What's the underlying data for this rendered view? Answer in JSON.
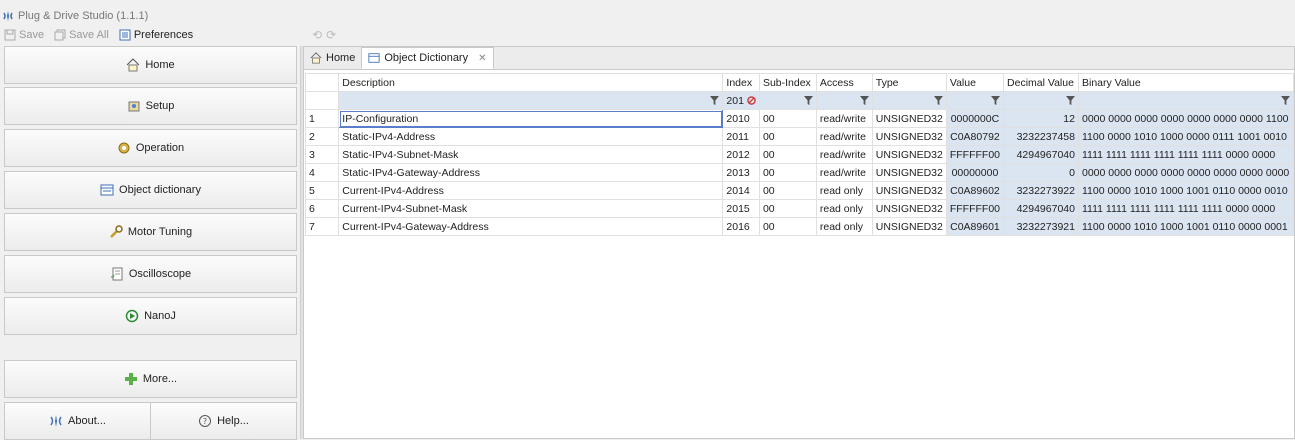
{
  "window": {
    "title": "Plug & Drive Studio (1.1.1)"
  },
  "toolbar": {
    "save_label": "Save",
    "save_all_label": "Save All",
    "preferences_label": "Preferences"
  },
  "sidebar": {
    "home": "Home",
    "setup": "Setup",
    "operation": "Operation",
    "object_dictionary": "Object dictionary",
    "motor_tuning": "Motor Tuning",
    "oscilloscope": "Oscilloscope",
    "nanoj": "NanoJ",
    "more": "More...",
    "about": "About...",
    "help": "Help..."
  },
  "tabs": {
    "home": "Home",
    "object_dictionary": "Object Dictionary"
  },
  "table": {
    "headers": {
      "description": "Description",
      "index": "Index",
      "sub_index": "Sub-Index",
      "access": "Access",
      "type": "Type",
      "value": "Value",
      "decimal_value": "Decimal Value",
      "binary_value": "Binary Value"
    },
    "index_filter": "201",
    "rows": [
      {
        "n": "1",
        "description": "IP-Configuration",
        "index": "2010",
        "sub": "00",
        "access": "read/write",
        "type": "UNSIGNED32",
        "value": "0000000C",
        "decimal": "12",
        "binary": "0000 0000 0000 0000 0000 0000 0000 1100"
      },
      {
        "n": "2",
        "description": "Static-IPv4-Address",
        "index": "2011",
        "sub": "00",
        "access": "read/write",
        "type": "UNSIGNED32",
        "value": "C0A80792",
        "decimal": "3232237458",
        "binary": "1100 0000 1010 1000 0000 0111 1001 0010"
      },
      {
        "n": "3",
        "description": "Static-IPv4-Subnet-Mask",
        "index": "2012",
        "sub": "00",
        "access": "read/write",
        "type": "UNSIGNED32",
        "value": "FFFFFF00",
        "decimal": "4294967040",
        "binary": "1111 1111 1111 1111 1111 1111 0000 0000"
      },
      {
        "n": "4",
        "description": "Static-IPv4-Gateway-Address",
        "index": "2013",
        "sub": "00",
        "access": "read/write",
        "type": "UNSIGNED32",
        "value": "00000000",
        "decimal": "0",
        "binary": "0000 0000 0000 0000 0000 0000 0000 0000"
      },
      {
        "n": "5",
        "description": "Current-IPv4-Address",
        "index": "2014",
        "sub": "00",
        "access": "read only",
        "type": "UNSIGNED32",
        "value": "C0A89602",
        "decimal": "3232273922",
        "binary": "1100 0000 1010 1000 1001 0110 0000 0010"
      },
      {
        "n": "6",
        "description": "Current-IPv4-Subnet-Mask",
        "index": "2015",
        "sub": "00",
        "access": "read only",
        "type": "UNSIGNED32",
        "value": "FFFFFF00",
        "decimal": "4294967040",
        "binary": "1111 1111 1111 1111 1111 1111 0000 0000"
      },
      {
        "n": "7",
        "description": "Current-IPv4-Gateway-Address",
        "index": "2016",
        "sub": "00",
        "access": "read only",
        "type": "UNSIGNED32",
        "value": "C0A89601",
        "decimal": "3232273921",
        "binary": "1100 0000 1010 1000 1001 0110 0000 0001"
      }
    ]
  },
  "colors": {
    "filter_row": "#dbe5f1",
    "selection": "#5b7cc8"
  }
}
